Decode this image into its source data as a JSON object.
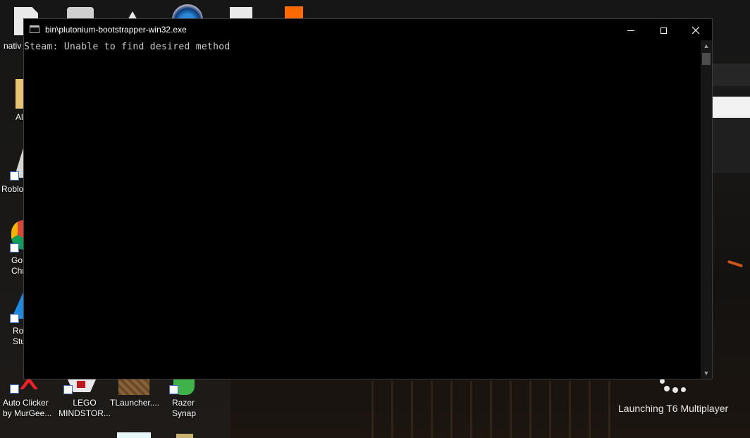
{
  "console": {
    "title": "bin\\plutonium-bootstrapper-win32.exe",
    "output_line": "Steam: Unable to find desired method"
  },
  "launcher": {
    "status": "Launching T6 Multiplayer"
  },
  "desktop": {
    "icons": [
      {
        "label": "nativ",
        "icon": "document-icon"
      },
      {
        "label": "Al",
        "icon": "folder-icon"
      },
      {
        "label": "Roblo",
        "icon": "roblox-icon"
      },
      {
        "label": "Go\nChr",
        "icon": "chrome-icon"
      },
      {
        "label": "Ro\nStu",
        "icon": "roblox-studio-icon"
      },
      {
        "label": "Auto Clicker\nby MurGee...",
        "icon": "autoclicker-icon"
      },
      {
        "label": "LEGO\nMINDSTOR...",
        "icon": "lego-icon"
      },
      {
        "label": "TLauncher....",
        "icon": "tlauncher-icon"
      },
      {
        "label": "Razer\nSynap",
        "icon": "razer-icon"
      }
    ]
  },
  "colors": {
    "console_bg": "#000000",
    "console_text": "#cccccc",
    "ember": "#d0541a"
  }
}
